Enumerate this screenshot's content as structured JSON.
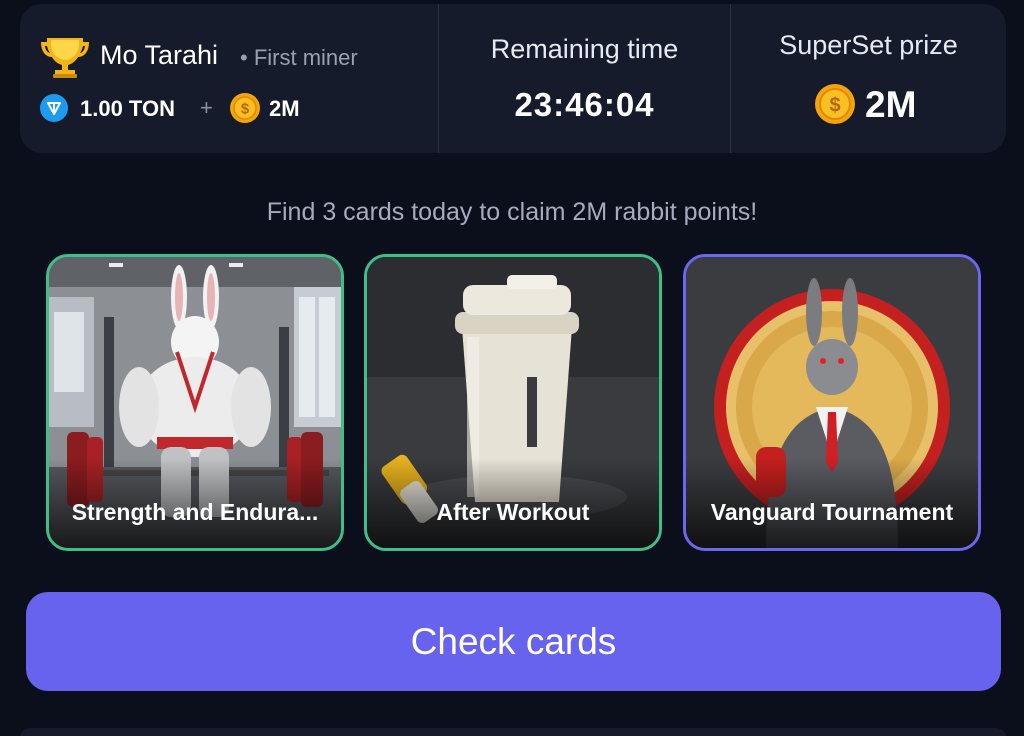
{
  "winner": {
    "name": "Mo Tarahi",
    "rank": "• First miner",
    "ton_amount": "1.00 TON",
    "plus": "+",
    "coin_amount": "2M"
  },
  "timer": {
    "title": "Remaining time",
    "value": "23:46:04"
  },
  "prize": {
    "title": "SuperSet prize",
    "value": "2M"
  },
  "instruction": "Find 3 cards today to claim 2M rabbit points!",
  "cards": [
    {
      "label": "Strength and Endura...",
      "border_color": "#3fbf87"
    },
    {
      "label": "After Workout",
      "border_color": "#3fbf87"
    },
    {
      "label": "Vanguard Tournament",
      "border_color": "#6b67ee"
    }
  ],
  "check_button": {
    "label": "Check cards",
    "color": "#6763ee"
  },
  "colors": {
    "background": "#0b0f1c",
    "panel": "#161b2b",
    "coin": "#f4a50c",
    "ton": "#1d9bf0"
  },
  "icons": {
    "trophy": "trophy-icon",
    "ton": "ton-icon",
    "coin": "coin-icon"
  }
}
